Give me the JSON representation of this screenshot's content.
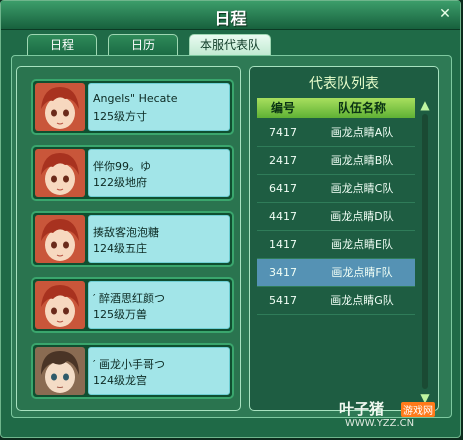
{
  "window": {
    "title": "日程",
    "close_glyph": "✕"
  },
  "tabs": [
    {
      "label": "日程",
      "active": false
    },
    {
      "label": "日历",
      "active": false
    },
    {
      "label": "本服代表队",
      "active": true
    }
  ],
  "members": [
    {
      "name": "Angels\" Hecate",
      "level": "125级方寸",
      "avatar": "red-hair-girl"
    },
    {
      "name": "伴你99。ゆ",
      "level": "122级地府",
      "avatar": "red-hair-girl"
    },
    {
      "name": "揍敌客泡泡糖",
      "level": "124级五庄",
      "avatar": "red-hair-girl"
    },
    {
      "name": "′ 醉酒思红颜つ",
      "level": "125级万兽",
      "avatar": "red-hair-girl"
    },
    {
      "name": "′ 画龙小手哥つ",
      "level": "124级龙宫",
      "avatar": "brown-hair-boy"
    }
  ],
  "team_list": {
    "title": "代表队列表",
    "headers": {
      "id": "编号",
      "team": "队伍名称"
    },
    "rows": [
      {
        "id": "7417",
        "team": "画龙点睛A队",
        "selected": false
      },
      {
        "id": "2417",
        "team": "画龙点睛B队",
        "selected": false
      },
      {
        "id": "6417",
        "team": "画龙点睛C队",
        "selected": false
      },
      {
        "id": "4417",
        "team": "画龙点睛D队",
        "selected": false
      },
      {
        "id": "1417",
        "team": "画龙点睛E队",
        "selected": false
      },
      {
        "id": "3417",
        "team": "画龙点睛F队",
        "selected": true
      },
      {
        "id": "5417",
        "team": "画龙点睛G队",
        "selected": false
      }
    ],
    "scroll_up": "▲",
    "scroll_down": "▼"
  },
  "watermark": {
    "brand": "叶子猪",
    "badge": "游戏网",
    "url": "WWW.YZZ.CN"
  },
  "colors": {
    "accent": "#5592b4",
    "header_green": "#8ccf4a"
  }
}
